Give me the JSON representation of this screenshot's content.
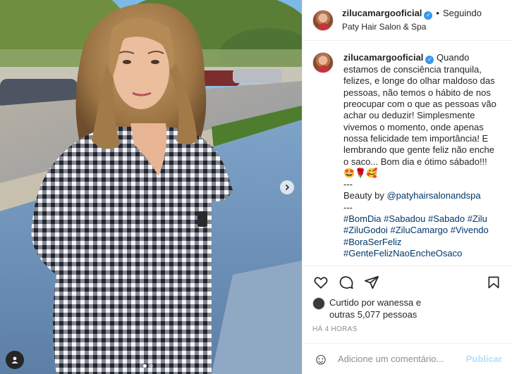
{
  "header": {
    "username": "zilucamargooficial",
    "separator": "•",
    "follow_status": "Seguindo",
    "location": "Paty Hair Salon & Spa",
    "more_label": "•••",
    "verified_label": "✓"
  },
  "caption": {
    "username": "zilucamargooficial",
    "text": "Quando estamos de consciência tranquila, felizes, e longe do olhar maldoso das pessoas, não temos o hábito de nos preocupar com o que as pessoas vão achar ou deduzir! Simplesmente vivemos o momento, onde apenas nossa felicidade tem importância! E lembrando que gente feliz não enche o saco... Bom dia e ótimo sábado!!! 🤩🌹🥰",
    "divider1": "---",
    "beauty_prefix": "Beauty by",
    "beauty_mention": "@patyhairsalonandspa",
    "divider2": "---",
    "hashtags": [
      "#BomDia",
      "#Sabadou",
      "#Sabado",
      "#Zilu",
      "#ZiluGodoi",
      "#ZiluCamargo",
      "#Vivendo",
      "#BoraSerFeliz",
      "#GenteFelizNaoEncheOsaco"
    ]
  },
  "likes": {
    "line1": "Curtido por wanessa e",
    "line2": "outras 5,077 pessoas"
  },
  "timestamp": "HÁ 4 HORAS",
  "comment_box": {
    "placeholder": "Adicione um comentário...",
    "publish_label": "Publicar",
    "emoji_label": "☺"
  },
  "carousel": {
    "slides": 2,
    "active": 1
  },
  "colors": {
    "verified": "#3897f0",
    "link": "#00376b",
    "publish_disabled": "#b2dffc",
    "muted": "#8e8e8e"
  },
  "icons": [
    "heart-icon",
    "comment-icon",
    "share-icon",
    "bookmark-icon",
    "chevron-right-icon",
    "user-tag-icon",
    "emoji-icon",
    "verified-icon"
  ]
}
